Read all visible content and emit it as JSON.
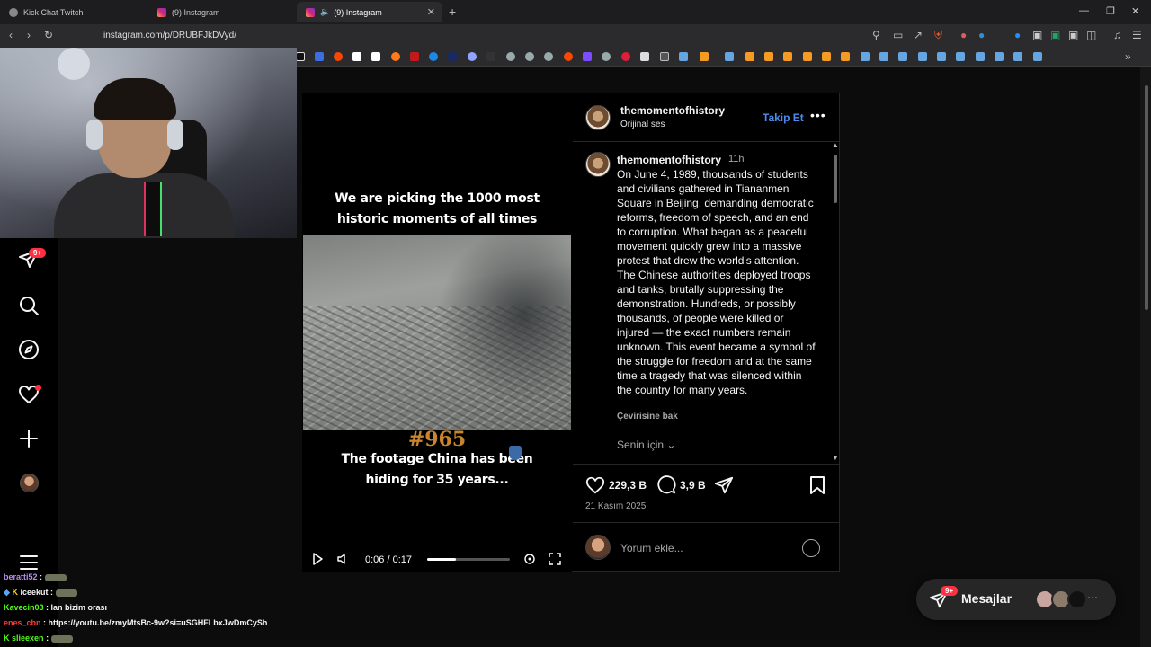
{
  "browser": {
    "tabs": [
      {
        "label": "Kick Chat Twitch",
        "active": false
      },
      {
        "label": "(9) Instagram",
        "active": false
      },
      {
        "label": "(9) Instagram",
        "active": true
      }
    ],
    "url": "instagram.com/p/DRUBFJkDVyd/"
  },
  "sidebar": {
    "notification_badge": "9+"
  },
  "video": {
    "top_title_line1": "We are picking the 1000 most",
    "top_title_line2": "historic moments of all times",
    "number": "#965",
    "caption_line1": "The footage China has been",
    "caption_line2": "hiding for 35 years...",
    "time": "0:06 / 0:17",
    "progress": 0.353
  },
  "post": {
    "username": "themomentofhistory",
    "audio": "Orijinal ses",
    "follow_label": "Takip Et",
    "caption_user": "themomentofhistory",
    "caption_time": "11h",
    "caption_text": "On June 4, 1989, thousands of students and civilians gathered in Tiananmen Square in Beijing, demanding democratic reforms, freedom of speech, and an end to corruption. What began as a peaceful movement quickly grew into a massive protest that drew the world's attention. The Chinese authorities deployed troops and tanks, brutally suppressing the demonstration. Hundreds, or possibly thousands, of people were killed or injured — the exact numbers remain unknown. This event became a symbol of the struggle for freedom and at the same time a tragedy that was silenced within the country for many years.",
    "translate_label": "Çevirisine bak",
    "for_you_label": "Senin için",
    "likes": "229,3 B",
    "comments": "3,9 B",
    "date": "21 Kasım 2025",
    "comment_placeholder": "Yorum ekle..."
  },
  "messages": {
    "label": "Mesajlar",
    "badge": "9+"
  },
  "chat": [
    {
      "user": "beratti52",
      "text": ":",
      "color": "#b98cf5"
    },
    {
      "user": "iceekut",
      "text": ":",
      "color": "#f5f5f5"
    },
    {
      "user": "Kavecin03",
      "text": ": lan bizim orası",
      "color": "#53fc18"
    },
    {
      "user": "enes_cbn",
      "text": ": https://youtu.be/zmyMtsBc-9w?si=uSGHFLbxJwDmCySh",
      "color": "#ff3b3b"
    },
    {
      "user": "slieexen",
      "text": ":",
      "color": "#53fc18"
    }
  ],
  "colors": {
    "accent_blue": "#4c8cf0",
    "badge_red": "#ff3040",
    "background": "#000000"
  }
}
